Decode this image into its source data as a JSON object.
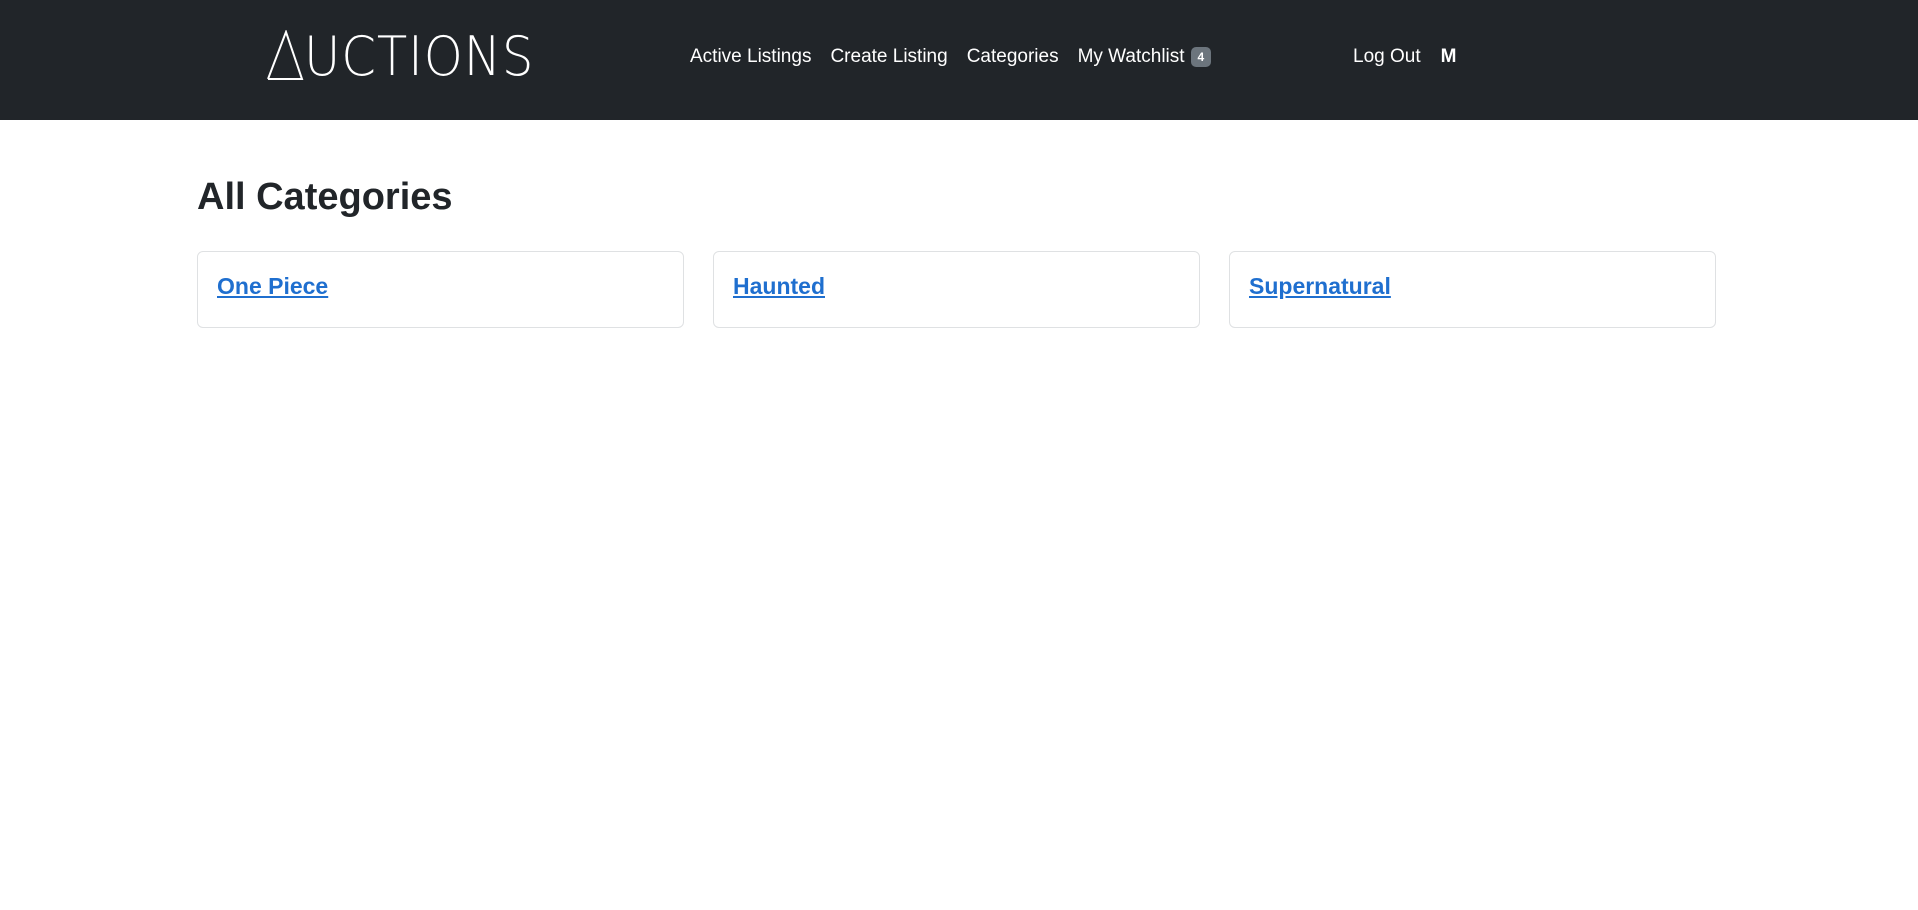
{
  "brand": {
    "text_rest": "UCTIONS"
  },
  "nav": {
    "items": [
      {
        "label": "Active Listings"
      },
      {
        "label": "Create Listing"
      },
      {
        "label": "Categories"
      },
      {
        "label": "My Watchlist",
        "badge": "4"
      }
    ],
    "logout_label": "Log Out",
    "user": "M"
  },
  "page": {
    "title": "All Categories"
  },
  "categories": [
    {
      "label": "One Piece"
    },
    {
      "label": "Haunted"
    },
    {
      "label": "Supernatural"
    }
  ],
  "colors": {
    "navbar_bg": "#212529",
    "link": "#1f6fcf",
    "badge_bg": "#6c757d"
  }
}
